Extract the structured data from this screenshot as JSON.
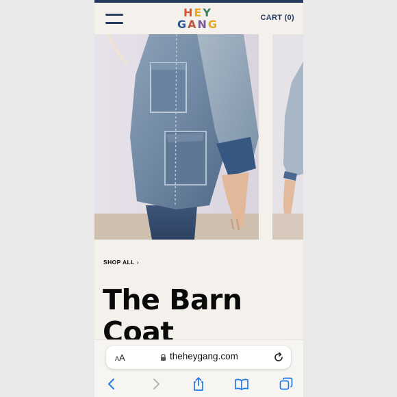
{
  "header": {
    "logo_line1": "HEY",
    "logo_line2": "GANG",
    "logo_colors": [
      "#d9542b",
      "#e8a524",
      "#3a7e5c",
      "#2f5a94",
      "#c0583f",
      "#7a5b9a",
      "#e3a91f"
    ],
    "cart_label": "CART (0)",
    "brand_color": "#253a5e"
  },
  "hero": {
    "images": [
      "model-wearing-denim-barn-coat",
      "side-view-denim-barn-coat"
    ]
  },
  "product": {
    "shop_all_label": "SHOP ALL",
    "title_line1": "The Barn",
    "title_line2": "Coat"
  },
  "browser": {
    "text_size_label": "AA",
    "url": "theheygang.com",
    "accent_color": "#1d7ae6",
    "nav_icons": [
      "back-icon",
      "forward-icon",
      "share-icon",
      "bookmarks-icon",
      "tabs-icon"
    ]
  }
}
